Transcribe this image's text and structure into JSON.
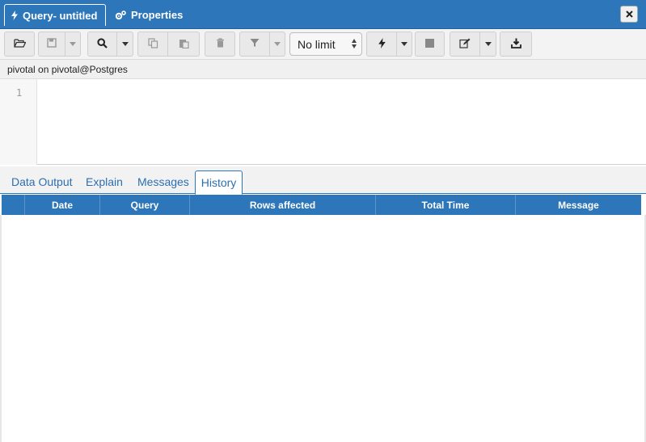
{
  "tabs": {
    "query_label": "Query- untitled",
    "properties_label": "Properties"
  },
  "toolbar": {
    "limit_value": "No limit"
  },
  "connection": {
    "label": "pivotal on pivotal@Postgres"
  },
  "editor": {
    "line_number": "1"
  },
  "result_tabs": [
    {
      "label": "Data Output"
    },
    {
      "label": "Explain"
    },
    {
      "label": "Messages"
    },
    {
      "label": "History"
    }
  ],
  "history_grid": {
    "columns": [
      "Date",
      "Query",
      "Rows affected",
      "Total Time",
      "Message"
    ]
  },
  "colors": {
    "accent": "#2c76b9",
    "link": "#2c6fb0"
  }
}
